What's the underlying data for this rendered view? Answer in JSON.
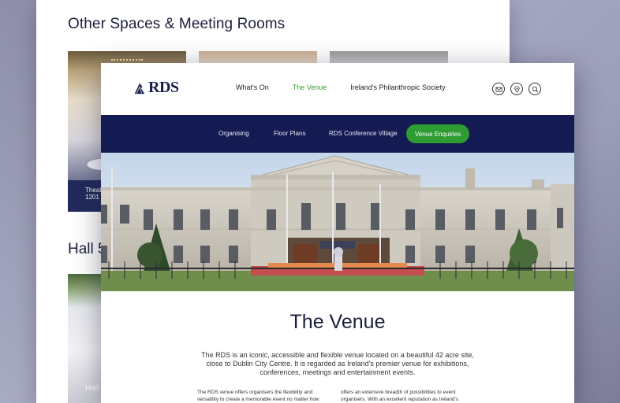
{
  "back_page": {
    "section_title": "Other Spaces & Meeting Rooms",
    "thumb_caption": "Theat\n1201",
    "section_title_2": "Hall 5",
    "thumb_caption_2": "Hall"
  },
  "header": {
    "logo_text": "RDS",
    "nav": [
      {
        "label": "What's On"
      },
      {
        "label": "The Venue",
        "active": true
      },
      {
        "label": "Ireland's Philanthropic Society"
      }
    ],
    "icons": [
      "mail-icon",
      "location-icon",
      "search-icon"
    ]
  },
  "subnav": {
    "items": [
      {
        "label": "Organising"
      },
      {
        "label": "Floor Plans"
      },
      {
        "label": "RDS Conference Village"
      }
    ],
    "cta_label": "Venue Enquiries"
  },
  "content": {
    "title": "The Venue",
    "intro": "The RDS is an iconic, accessible and flexible venue located on a beautiful 42 acre site, close to Dublin City Centre. It is regarded as Ireland's premier venue for exhibitions, conferences, meetings and entertainment events.",
    "col_left": "The RDS venue offers organisers the flexibility and versatility to create a memorable event no matter how",
    "col_right": "offers an extensive breadth of possibilities to event organisers. With an excellent reputation as Ireland's"
  },
  "colors": {
    "navy": "#141a52",
    "green_cta": "#2e9c33",
    "active_nav": "#35a033",
    "title_text": "#1b1f3b"
  }
}
